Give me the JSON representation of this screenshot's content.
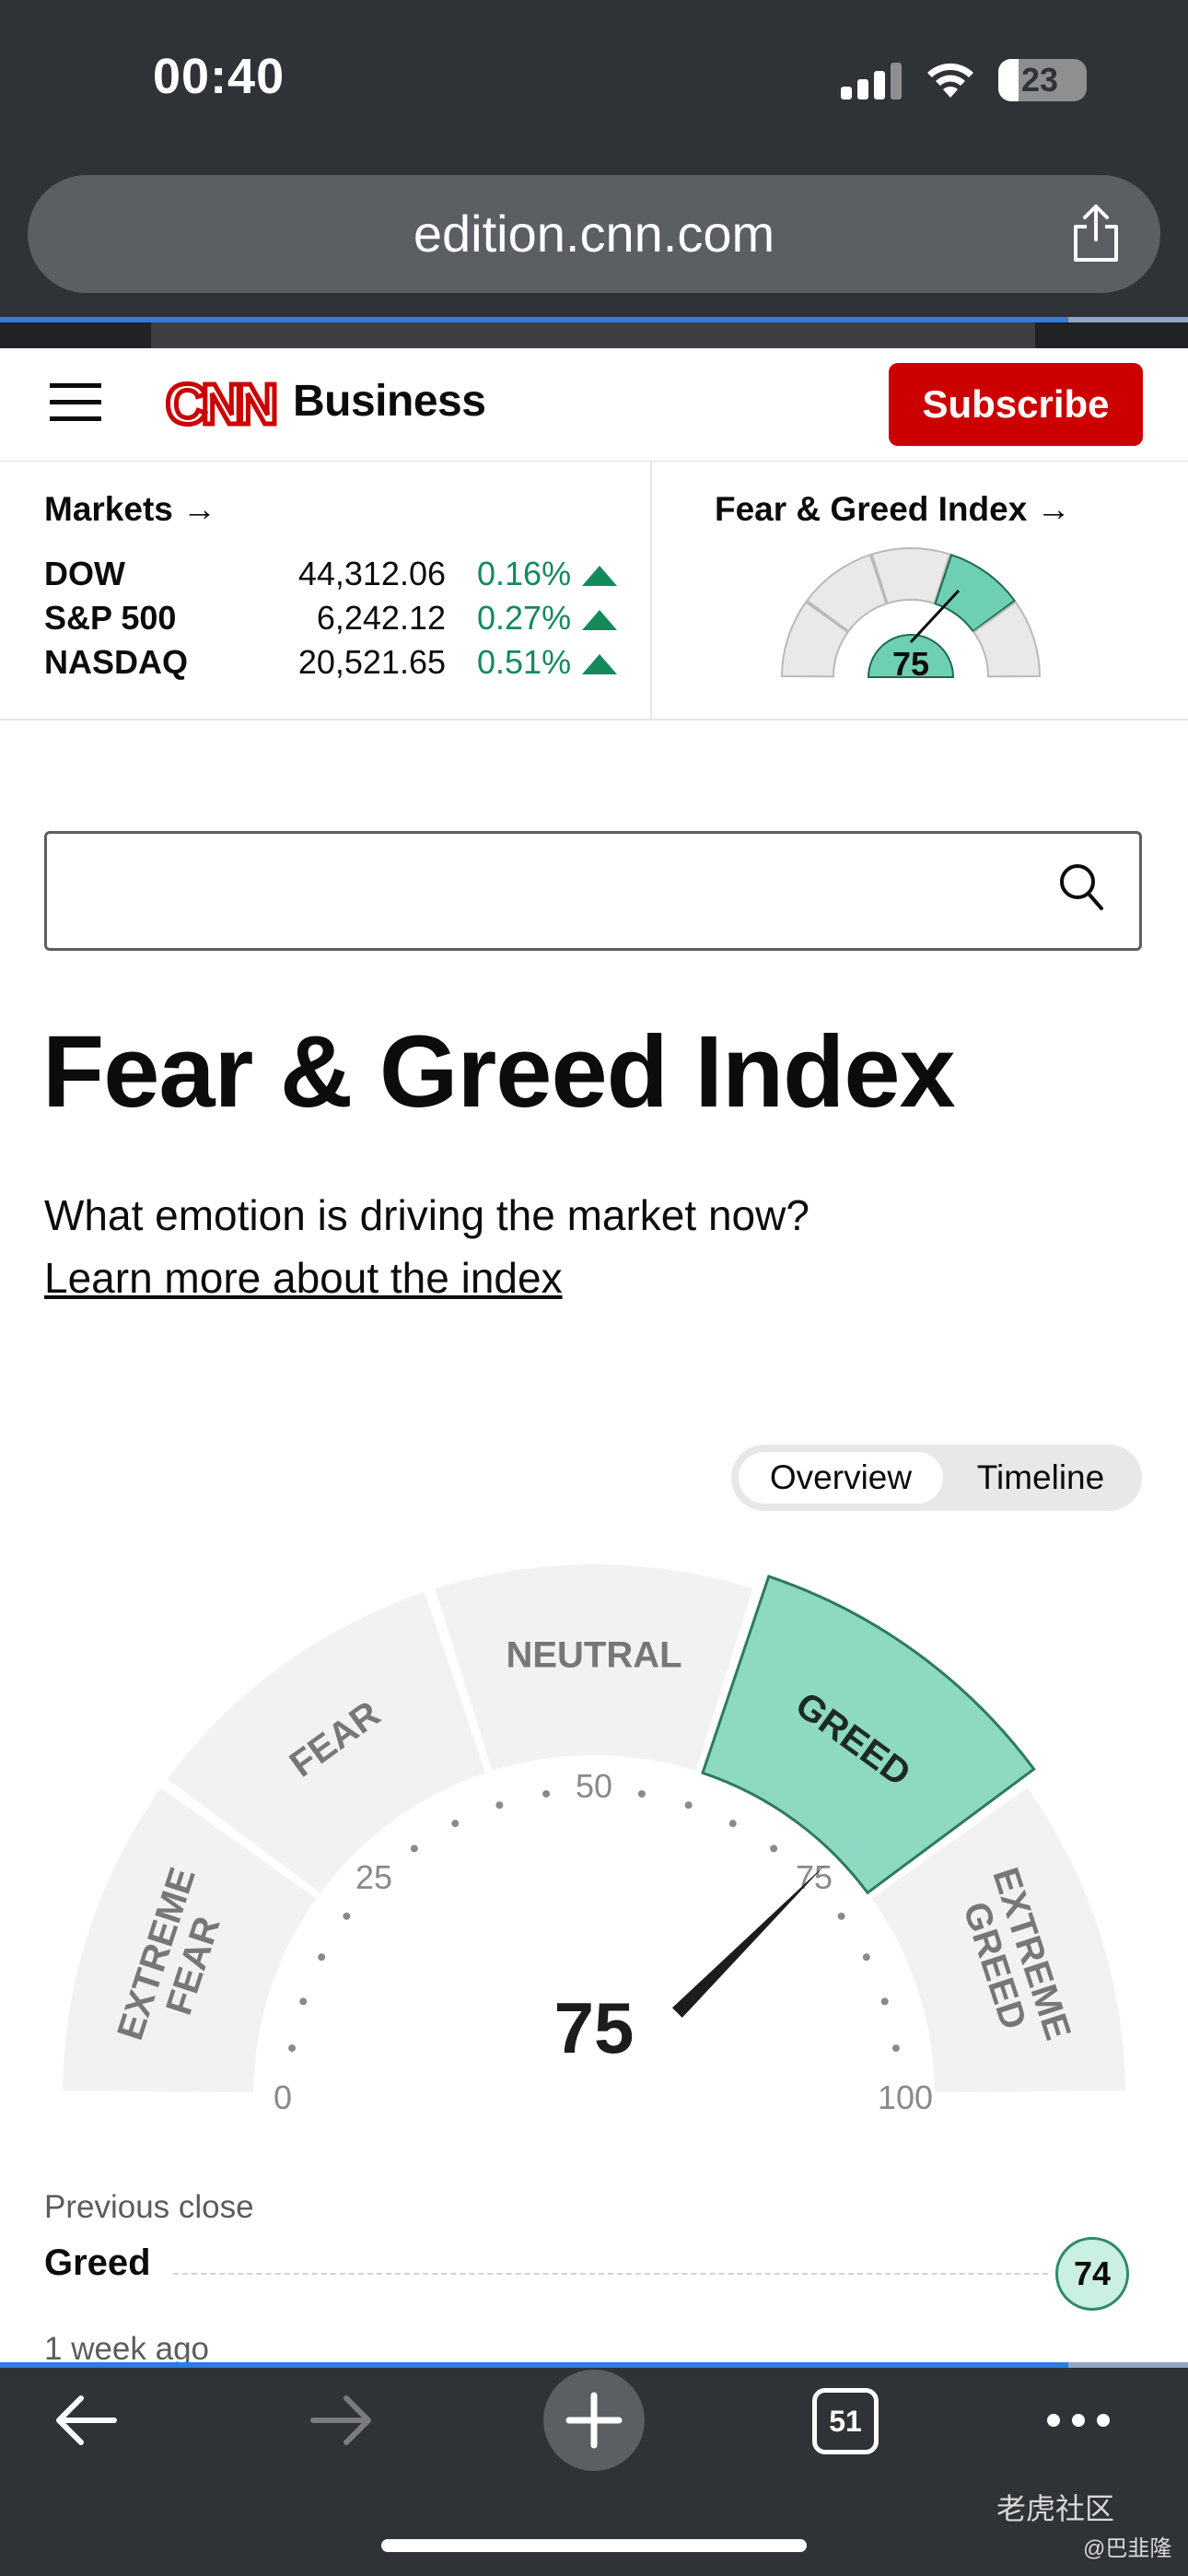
{
  "status_bar": {
    "time": "00:40",
    "battery": "23"
  },
  "browser": {
    "url": "edition.cnn.com",
    "open_tabs": "51"
  },
  "header": {
    "logo_text": "CNN",
    "section": "Business",
    "subscribe_label": "Subscribe"
  },
  "markets": {
    "title": "Markets →",
    "items": [
      {
        "name": "DOW",
        "value": "44,312.06",
        "change": "0.16%"
      },
      {
        "name": "S&P 500",
        "value": "6,242.12",
        "change": "0.27%"
      },
      {
        "name": "NASDAQ",
        "value": "20,521.65",
        "change": "0.51%"
      }
    ]
  },
  "fear_greed_mini": {
    "title": "Fear & Greed Index →",
    "value": "75"
  },
  "page": {
    "title": "Fear & Greed Index",
    "subtitle": "What emotion is driving the market now?",
    "learn_more": "Learn more about the index"
  },
  "toggle": {
    "overview": "Overview",
    "timeline": "Timeline"
  },
  "gauge": {
    "value": "75",
    "segments": [
      "EXTREME FEAR",
      "FEAR",
      "NEUTRAL",
      "GREED",
      "EXTREME GREED"
    ],
    "ticks": [
      "0",
      "25",
      "50",
      "75",
      "100"
    ],
    "active_color": "#8ed9c1",
    "inactive_color": "#f2f2f2"
  },
  "previous_close": {
    "label": "Previous close",
    "rating": "Greed",
    "value": "74"
  },
  "week_ago": {
    "label": "1 week ago"
  },
  "watermark": {
    "text": "老虎社区",
    "handle": "@巴韭隆"
  }
}
